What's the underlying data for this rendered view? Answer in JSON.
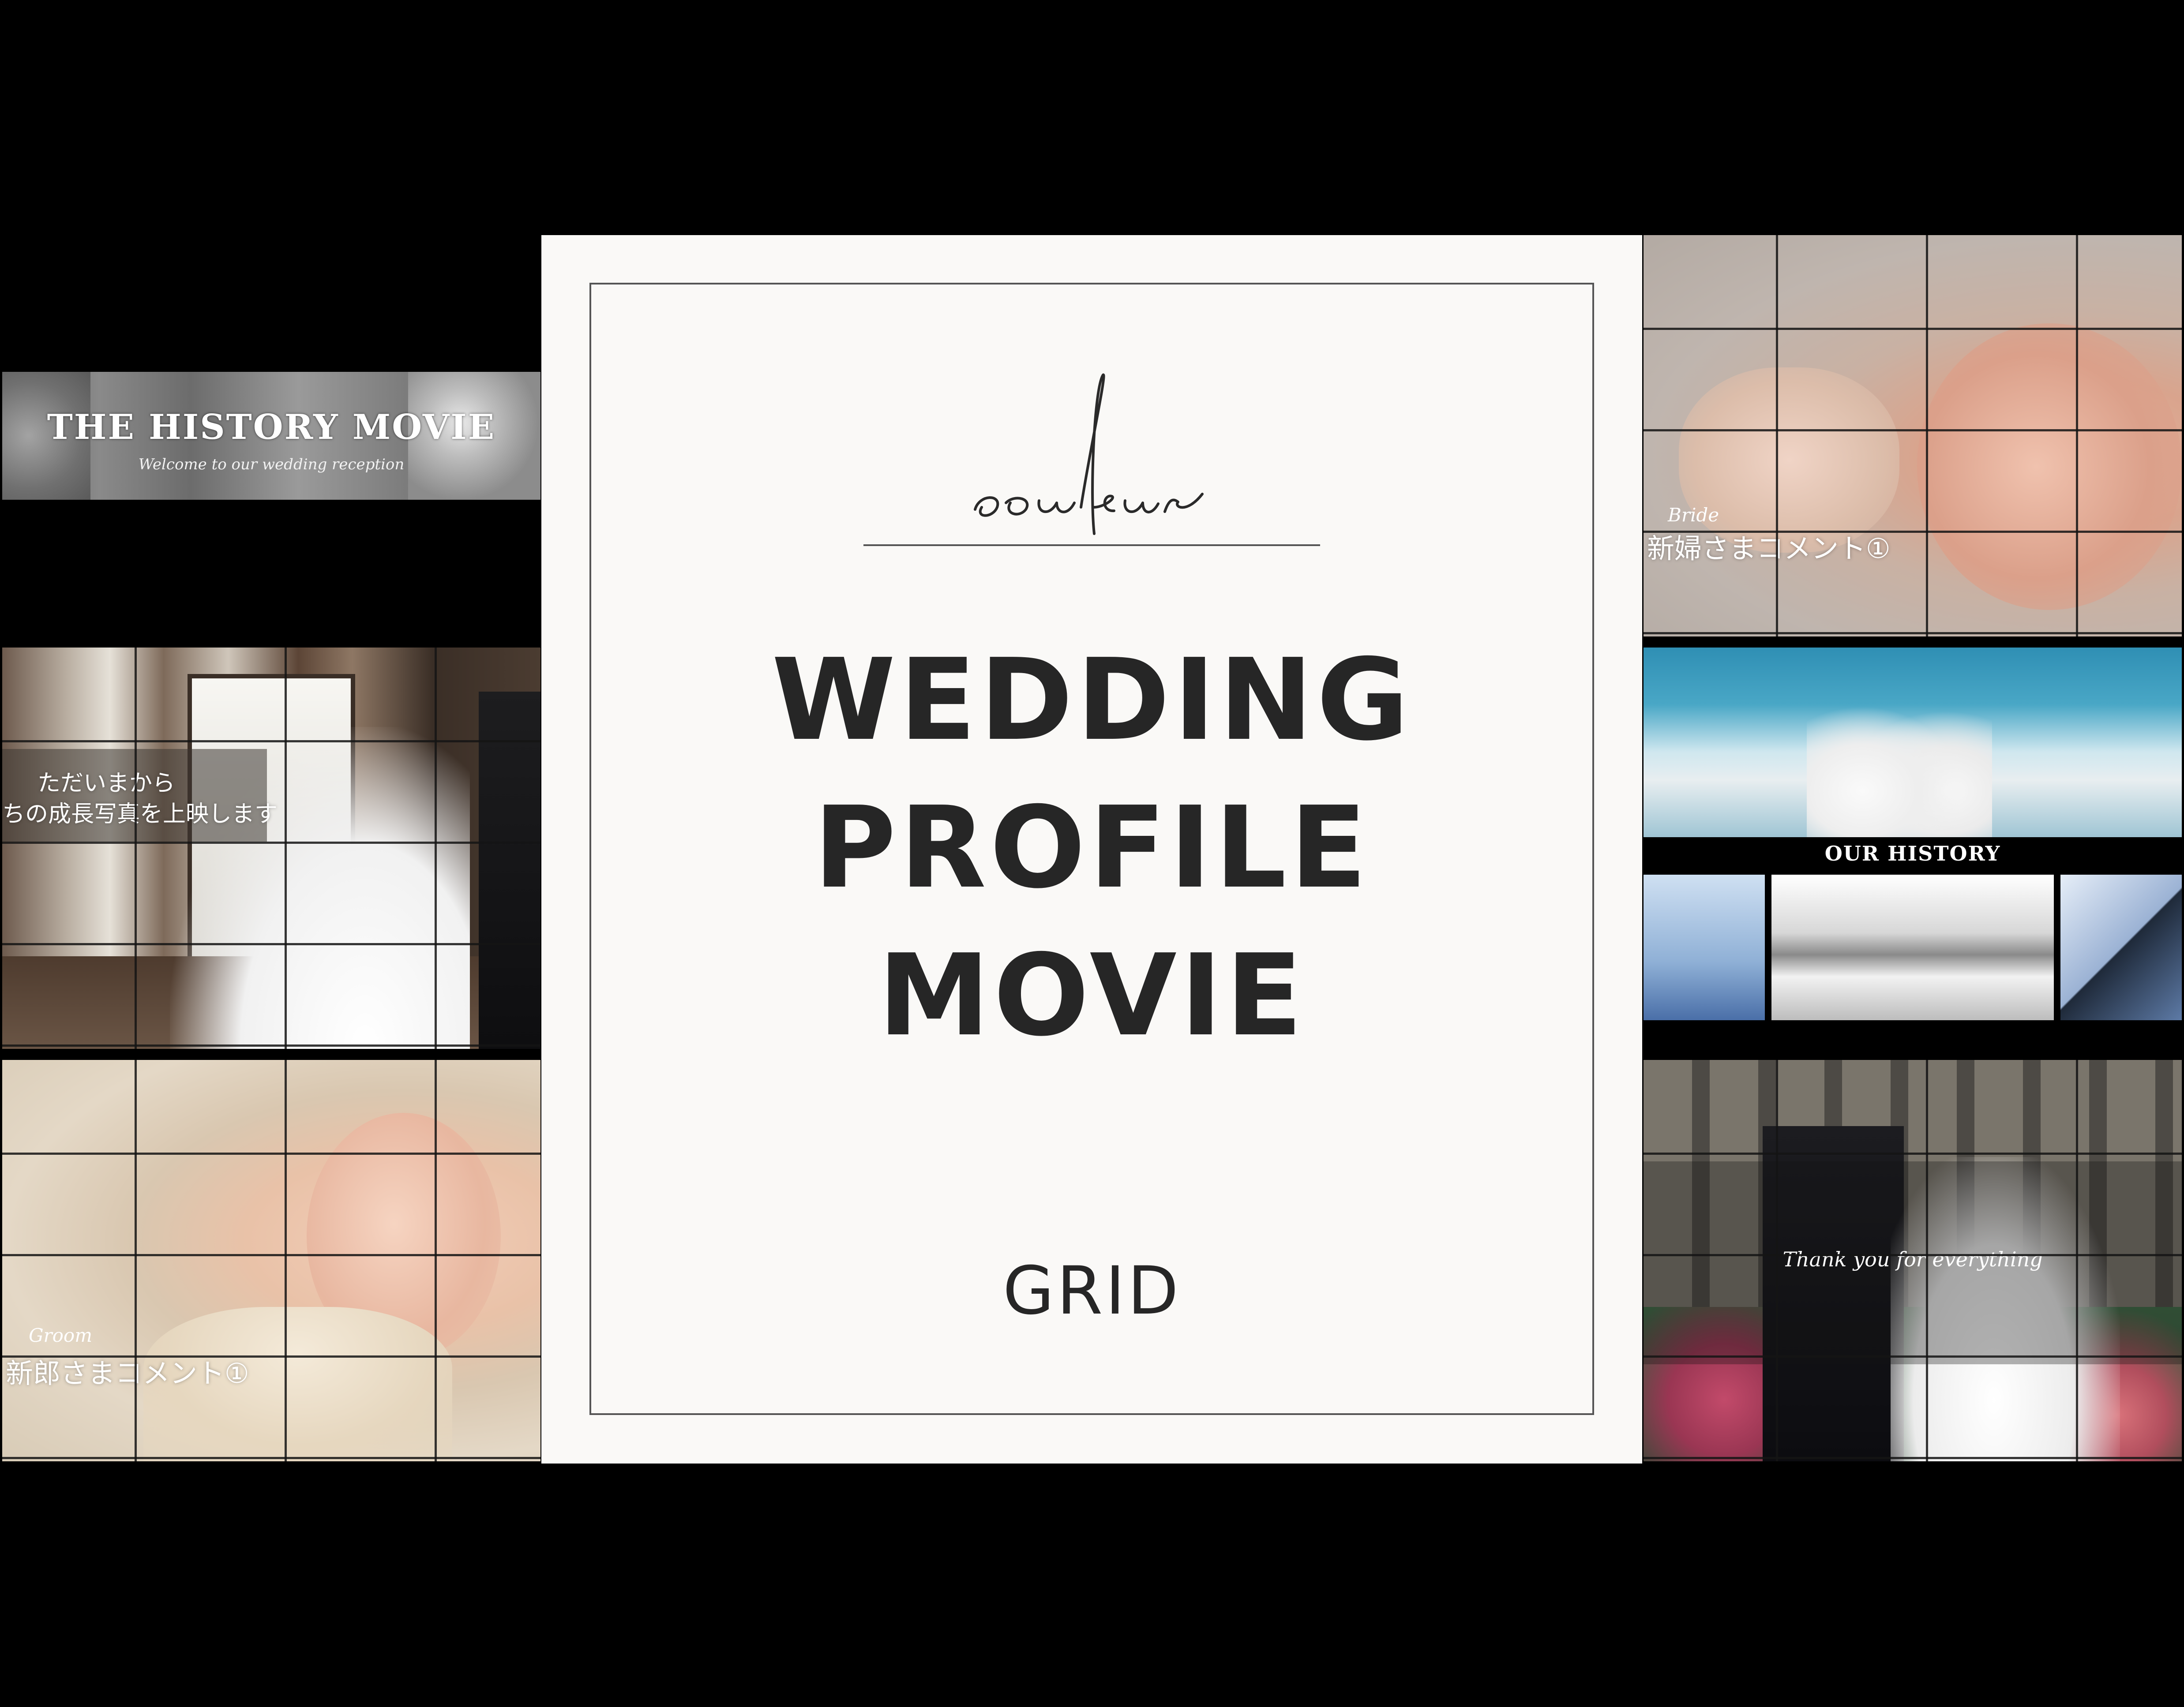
{
  "colors": {
    "background": "#000000",
    "card": "#faf9f7",
    "title_text": "#262626",
    "frame_line": "#555555"
  },
  "brand": {
    "script": "couleur"
  },
  "title": {
    "lines": [
      "WEDDING",
      "PROFILE",
      "MOVIE"
    ]
  },
  "subtitle": "GRID",
  "thumbnails": {
    "history": {
      "title": "THE HISTORY MOVIE",
      "tagline": "Welcome to our wedding reception"
    },
    "chapel": {
      "lines": [
        "ただいまから",
        "ちの成長写真を上映します"
      ]
    },
    "groom": {
      "script": "Groom",
      "comment": "新郎さまコメント①"
    },
    "bride": {
      "script": "Bride",
      "comment": "新婦さまコメント①"
    },
    "our_history": {
      "banner": "OUR HISTORY"
    },
    "thanks": {
      "script": "Thank you for everything"
    }
  }
}
